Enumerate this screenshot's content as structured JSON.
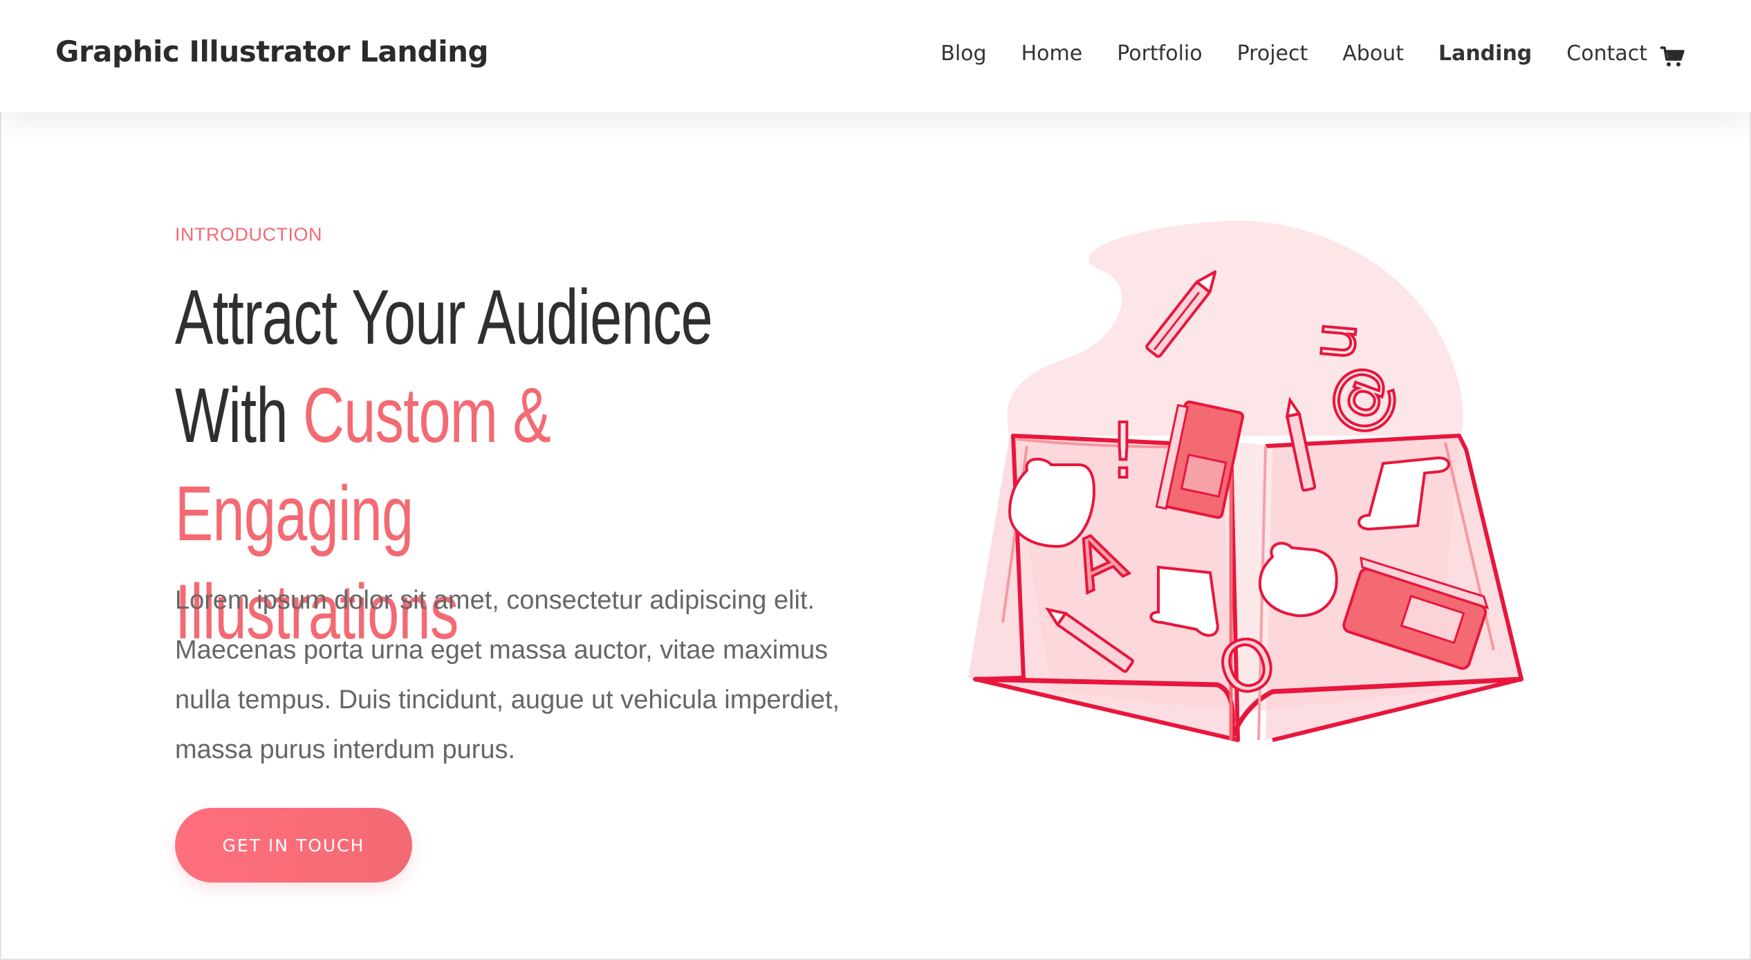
{
  "header": {
    "brand": "Graphic Illustrator Landing",
    "nav": [
      {
        "label": "Blog",
        "active": false
      },
      {
        "label": "Home",
        "active": false
      },
      {
        "label": "Portfolio",
        "active": false
      },
      {
        "label": "Project",
        "active": false
      },
      {
        "label": "About",
        "active": false
      },
      {
        "label": "Landing",
        "active": true
      },
      {
        "label": "Contact",
        "active": false
      }
    ],
    "cart_icon": "shopping-cart-icon"
  },
  "hero": {
    "eyebrow": "INTRODUCTION",
    "headline_line1": "Attract Your Audience",
    "headline_line2_plain": "With ",
    "headline_line2_accent": "Custom & Engaging",
    "headline_line3_accent": "Illustrations",
    "body": "Lorem ipsum dolor sit amet, consectetur adipiscing elit. Maecenas porta urna eget massa auctor, vitae maximus nulla tempus. Duis tincidunt, augue ut vehicula imperdiet, massa purus interdum purus.",
    "cta_label": "GET IN TOUCH",
    "illustration_letters": {
      "u": "u",
      "at": "@",
      "exclaim": "!",
      "a": "A",
      "o": "O"
    }
  },
  "colors": {
    "accent": "#f36a73",
    "accent_dark": "#e8163c",
    "blush": "#fde6e8",
    "text": "#2f2f2f",
    "muted": "#666666"
  }
}
